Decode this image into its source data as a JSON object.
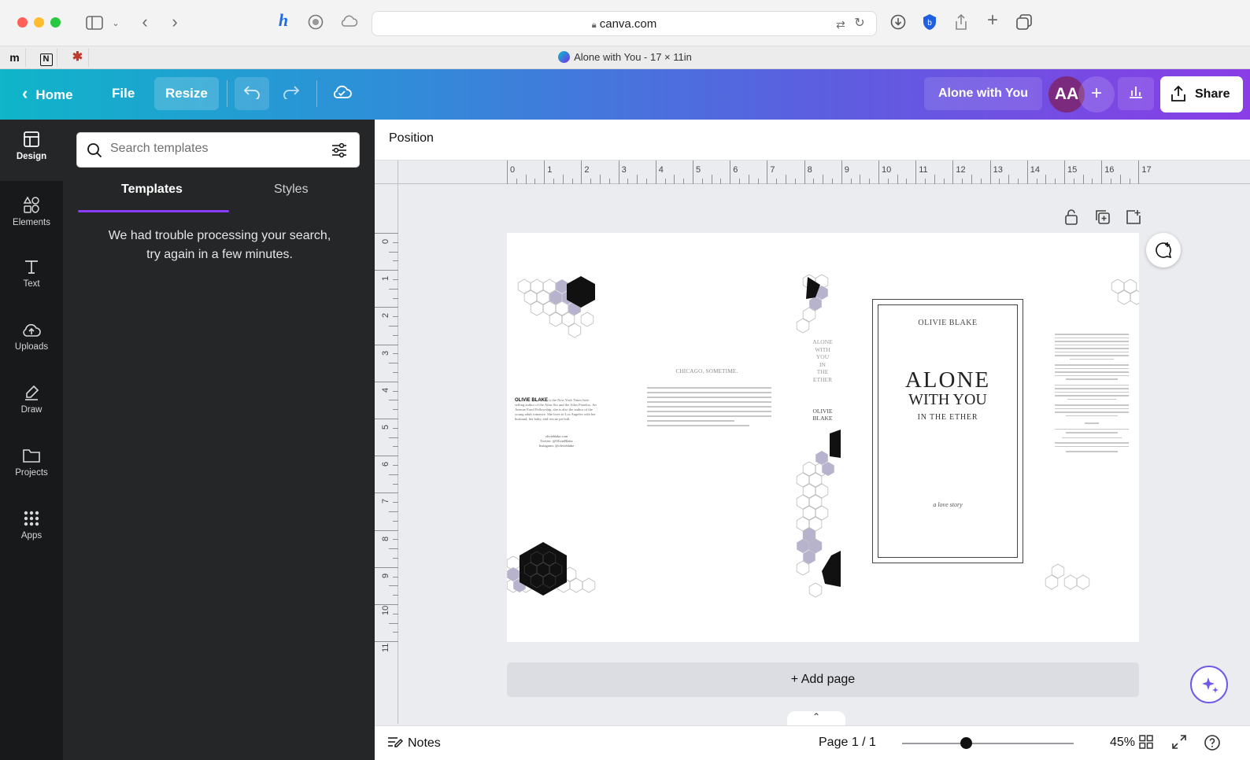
{
  "browser": {
    "url": "canva.com",
    "tab_title": "Alone with You - 17 × 11in",
    "bookmarks": [
      "m",
      "N"
    ]
  },
  "header": {
    "home_label": "Home",
    "file_label": "File",
    "resize_label": "Resize",
    "doc_title": "Alone with You",
    "avatar_initials": "AA",
    "share_label": "Share"
  },
  "rail": {
    "items": [
      {
        "label": "Design",
        "icon": "layout-icon"
      },
      {
        "label": "Elements",
        "icon": "shapes-icon"
      },
      {
        "label": "Text",
        "icon": "text-icon"
      },
      {
        "label": "Uploads",
        "icon": "cloud-upload-icon"
      },
      {
        "label": "Draw",
        "icon": "pen-icon"
      },
      {
        "label": "Projects",
        "icon": "folder-icon"
      },
      {
        "label": "Apps",
        "icon": "grid-icon"
      }
    ]
  },
  "panel": {
    "search_placeholder": "Search templates",
    "tabs": [
      "Templates",
      "Styles"
    ],
    "message_line1": "We had trouble processing your search,",
    "message_line2": "try again in a few minutes."
  },
  "workspace": {
    "position_label": "Position",
    "ruler_h": [
      "0",
      "1",
      "2",
      "3",
      "4",
      "5",
      "6",
      "7",
      "8",
      "9",
      "10",
      "11",
      "12",
      "13",
      "14",
      "15",
      "16",
      "17"
    ],
    "ruler_v": [
      "0",
      "1",
      "2",
      "3",
      "4",
      "5",
      "6",
      "7",
      "8",
      "9",
      "10",
      "11"
    ],
    "add_page_label": "+ Add page"
  },
  "design": {
    "chicago_heading": "CHICAGO, SOMETIME.",
    "author_bio_name": "OLIVIE BLAKE",
    "author_contact": [
      "olivieblake.com",
      "Twitter: @OlivieBlake",
      "Instagram: @olivieblake"
    ],
    "spine_title": [
      "ALONE",
      "WITH",
      "YOU",
      "IN",
      "THE",
      "ETHER"
    ],
    "spine_author": [
      "OLIVIE",
      "BLAKE"
    ],
    "cover_author": "OLIVIE BLAKE",
    "cover_title_line1": "ALONE",
    "cover_title_line2": "WITH YOU",
    "cover_subtitle": "IN THE ETHER",
    "cover_tagline": "a love story"
  },
  "footer": {
    "notes_label": "Notes",
    "page_indicator": "Page 1 / 1",
    "zoom_value": "45%",
    "zoom_fraction": 0.37
  },
  "colors": {
    "accent": "#8b3dff",
    "header_start": "#0fb5c9",
    "header_end": "#8a3de6",
    "rail_bg": "#18191b",
    "panel_bg": "#252627"
  }
}
